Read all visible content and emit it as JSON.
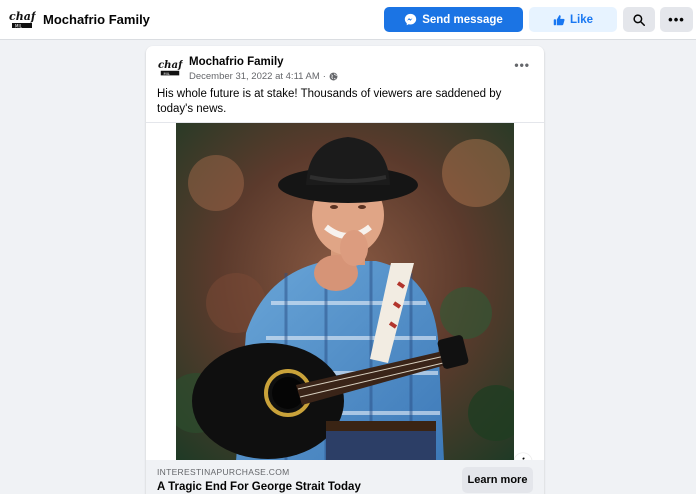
{
  "header": {
    "page_name": "Mochafrio Family",
    "logo_text": "chaf",
    "send_message_label": "Send message",
    "like_label": "Like"
  },
  "post": {
    "author": "Mochafrio Family",
    "timestamp": "December 31, 2022 at 4:11 AM",
    "separator": "·",
    "audience_icon": "globe-icon",
    "body": "His whole future is at stake! Thousands of viewers are saddened by today's news.",
    "link": {
      "domain": "INTERESTINAPURCHASE.COM",
      "title": "A Tragic End For George Strait Today",
      "cta_label": "Learn more"
    }
  },
  "colors": {
    "primary_blue": "#1b74e4",
    "like_bg": "#e7f3ff",
    "page_bg": "#f0f2f5"
  }
}
